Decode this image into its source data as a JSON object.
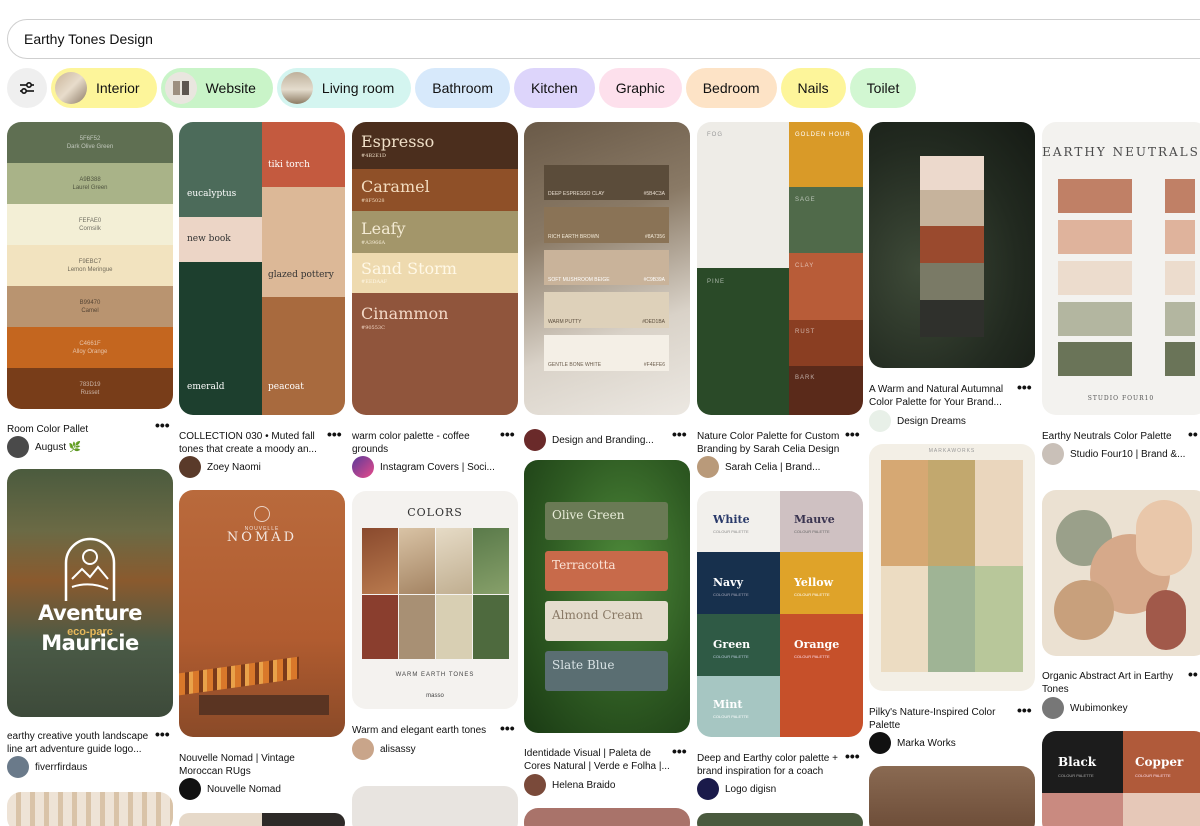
{
  "search": {
    "value": "Earthy Tones Design"
  },
  "chips": [
    {
      "label": "Interior",
      "bg": "#fdf59a"
    },
    {
      "label": "Website",
      "bg": "#c9f4c8"
    },
    {
      "label": "Living room",
      "bg": "#d4f5f0"
    },
    {
      "label": "Bathroom",
      "bg": "#d7e9fb"
    },
    {
      "label": "Kitchen",
      "bg": "#ddd5fb"
    },
    {
      "label": "Graphic",
      "bg": "#fde0ec"
    },
    {
      "label": "Bedroom",
      "bg": "#fde3c6"
    },
    {
      "label": "Nails",
      "bg": "#fdf59a"
    },
    {
      "label": "Toilet",
      "bg": "#d2f7d2"
    }
  ],
  "pins": {
    "p1": {
      "swatches": [
        {
          "hex": "5F6F52",
          "name": "Dark Olive Green",
          "color": "#5f6f52"
        },
        {
          "hex": "A9B388",
          "name": "Laurel Green",
          "color": "#a9b388"
        },
        {
          "hex": "FEFAE0",
          "name": "Cornsilk",
          "color": "#f3efd6"
        },
        {
          "hex": "F9EBC7",
          "name": "Lemon Meringue",
          "color": "#f2e3bf"
        },
        {
          "hex": "B99470",
          "name": "Camel",
          "color": "#b99470"
        },
        {
          "hex": "C4661F",
          "name": "Alloy Orange",
          "color": "#c4661f"
        },
        {
          "hex": "783D19",
          "name": "Russet",
          "color": "#783d19"
        }
      ],
      "title": "Room Color Pallet",
      "author": "August 🌿"
    },
    "p2": {
      "labels": [
        "tiki torch",
        "eucalyptus",
        "new book",
        "glazed pottery",
        "emerald",
        "peacoat"
      ],
      "title": "COLLECTION 030 • Muted fall tones that create a moody an...",
      "author": "Zoey Naomi"
    },
    "p3": {
      "swatches": [
        {
          "name": "Espresso",
          "hex": "#4B2E1D"
        },
        {
          "name": "Caramel",
          "hex": "#8F5028"
        },
        {
          "name": "Leafy",
          "hex": "#A3966A"
        },
        {
          "name": "Sand Storm",
          "hex": "#EEDAAF"
        },
        {
          "name": "Cinammon",
          "hex": "#90553C"
        }
      ],
      "title": "warm color palette - coffee grounds",
      "author": "Instagram Covers | Soci..."
    },
    "p4": {
      "swatches": [
        {
          "name": "DEEP ESPRESSO CLAY",
          "hex": "#5B4C3A"
        },
        {
          "name": "RICH EARTH BROWN",
          "hex": "#8A7356"
        },
        {
          "name": "SOFT MUSHROOM BEIGE",
          "hex": "#C9B39A"
        },
        {
          "name": "WARM PUTTY",
          "hex": "#DED1BA"
        },
        {
          "name": "GENTLE BONE WHITE",
          "hex": "#F4EFE6"
        }
      ],
      "author": "Design and Branding..."
    },
    "p5": {
      "labels": [
        "FOG",
        "GOLDEN HOUR",
        "SAGE",
        "PINE",
        "CLAY",
        "RUST",
        "BARK"
      ],
      "title": "Nature Color Palette for Custom Branding by Sarah Celia Design",
      "author": "Sarah Celia | Brand..."
    },
    "p6": {
      "title": "A Warm and Natural Autumnal Color Palette for Your Brand...",
      "author": "Design Dreams"
    },
    "p7": {
      "heading": "EARTHY NEUTRALS",
      "footer": "STUDIO FOUR10",
      "title": "Earthy Neutrals Color Palette",
      "author": "Studio Four10 | Brand &..."
    },
    "p8": {
      "line1": "Aventure",
      "line2": "eco-parc",
      "line3": "Mauricie",
      "title": "earthy creative youth landscape line art adventure guide logo...",
      "author": "fiverrfirdaus"
    },
    "p9": {
      "brand": "NOMAD",
      "brand_small": "NOUVELLE",
      "title": "Nouvelle Nomad | Vintage Moroccan RUgs",
      "author": "Nouvelle Nomad"
    },
    "p10": {
      "heading": "COLORS",
      "footer": "WARM EARTH TONES",
      "mark": "masso",
      "title": "Warm and elegant earth tones",
      "author": "alisassy"
    },
    "p11": {
      "swatches": [
        "Olive Green",
        "Terracotta",
        "Almond Cream",
        "Slate Blue"
      ],
      "title": "Identidade Visual | Paleta de Cores Natural | Verde e Folha |...",
      "author": "Helena Braido"
    },
    "p12": {
      "swatches": [
        {
          "name": "White",
          "sub": "COLOUR PALETTE"
        },
        {
          "name": "Mauve",
          "sub": "COLOUR PALETTE"
        },
        {
          "name": "Navy",
          "sub": "COLOUR PALETTE"
        },
        {
          "name": "Yellow",
          "sub": "COLOUR PALETTE"
        },
        {
          "name": "Green",
          "sub": "COLOUR PALETTE"
        },
        {
          "name": "Orange",
          "sub": "COLOUR PALETTE"
        },
        {
          "name": "Mint",
          "sub": "COLOUR PALETTE"
        }
      ],
      "title": "Deep and Earthy color palette + brand inspiration for a coach",
      "author": "Logo digisn"
    },
    "p13": {
      "brand": "MARKAWORKS",
      "title": "Pilky's Nature-Inspired Color Palette",
      "author": "Marka Works"
    },
    "p14": {
      "title": "Organic Abstract Art in Earthy Tones",
      "author": "Wubimonkey"
    },
    "p15": {
      "swatches": [
        {
          "name": "Black",
          "sub": "COLOUR PALETTE"
        },
        {
          "name": "Copper",
          "sub": "COLOUR PALETTE"
        }
      ]
    }
  },
  "icons": {
    "filter": "sliders-icon",
    "more": "more-dots-icon"
  }
}
